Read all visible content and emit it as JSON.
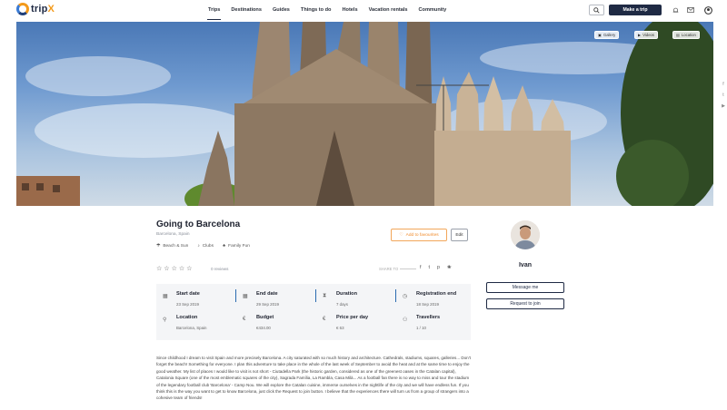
{
  "header": {
    "logo_text_a": "trip",
    "logo_text_b": "X",
    "nav": [
      "Trips",
      "Destinations",
      "Guides",
      "Things to do",
      "Hotels",
      "Vacation rentals",
      "Community"
    ],
    "active_nav": "Trips",
    "make_trip_label": "Make a trip"
  },
  "hero": {
    "buttons": [
      "Gallery",
      "Videos",
      "Location"
    ]
  },
  "trip": {
    "title": "Going to Barcelona",
    "location": "Barcelona, Spain",
    "tags": [
      "Beach & Sun",
      "Clubs",
      "Family Fun"
    ],
    "favourite_label": "Add to favourites",
    "edit_label": "Edit",
    "reviews": "0 reviews",
    "share_label": "SHARE TO",
    "stats": [
      {
        "label": "Start date",
        "value": "23 Sep 2019",
        "icon": "calendar-icon"
      },
      {
        "label": "End date",
        "value": "29 Sep 2019",
        "icon": "calendar-icon"
      },
      {
        "label": "Duration",
        "value": "7 days",
        "icon": "hourglass-icon"
      },
      {
        "label": "Registration end",
        "value": "18 Sep 2019",
        "icon": "clock-icon"
      },
      {
        "label": "Location",
        "value": "Barcelona, Spain",
        "icon": "pin-icon"
      },
      {
        "label": "Budget",
        "value": "€434.00",
        "icon": "euro-icon"
      },
      {
        "label": "Price per day",
        "value": "€ 63",
        "icon": "euro-icon"
      },
      {
        "label": "Travellers",
        "value": "1 / 10",
        "icon": "people-icon"
      }
    ],
    "description": "Since childhood I dream to visit Spain and more precisely Barcelona. A city saturated with so much history and architecture. Cathedrals, stadiums, squares, galleries... Don't forget the beach! Something for everyone. I plan this adventure to take place in the whole of the last week of September to avoid the heat and at the same time to enjoy the good weather. My list of places I would like to visit is not short - Ciutadella Park (the historic garden, considered as one of the greenest oases in the Catalan capital), Catalonia Square (one of the most emblematic squares of the city), Sagrada Família, La Rambla, Casa Milà... As a football fan there is no way to miss and tour the stadium of the legendary football club 'Barcelona' - Camp Nou. We will explore the Catalan cuisine, immerse ourselves in the nightlife of the city and we will have endless fun. If you think this is the way you want to get to know Barcelona, just click the Request to join button. I believe that the experiences there will turn us from a group of strangers into a cohesive team of friends!"
  },
  "profile": {
    "name": "Ivan",
    "message_label": "Message me",
    "join_label": "Request to join"
  },
  "colors": {
    "brand_dark": "#1f2a44",
    "accent_orange": "#f08a2a",
    "divider_blue": "#2b6bb0"
  }
}
